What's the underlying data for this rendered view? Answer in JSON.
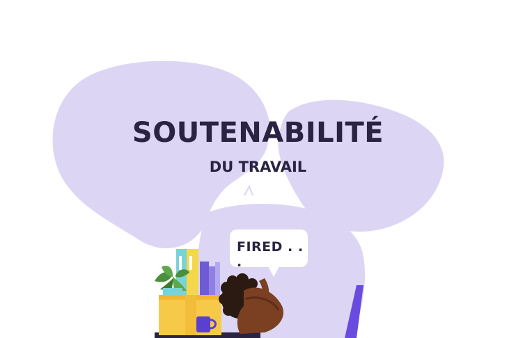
{
  "headline": {
    "title": "SOUTENABILITÉ",
    "subtitle": "DU TRAVAIL"
  },
  "speech_bubble": {
    "text": "FIRED . . ."
  },
  "colors": {
    "background": "#ffffff",
    "blob": "#dcd6f4",
    "text": "#2a2342",
    "box": "#f7c948",
    "binder_yellow": "#f5d84a",
    "binder_teal": "#7ad3d6",
    "binder_purple": "#6f5bd6",
    "mug": "#5b3fd0",
    "chair": "#6a4be0",
    "skin": "#7b3f22",
    "hair": "#2a1a12",
    "plant": "#4a8f3a"
  },
  "icons": [
    "plant-icon",
    "binder-icon",
    "mug-icon",
    "box-icon",
    "chair-icon",
    "person-icon",
    "speech-bubble-icon"
  ]
}
